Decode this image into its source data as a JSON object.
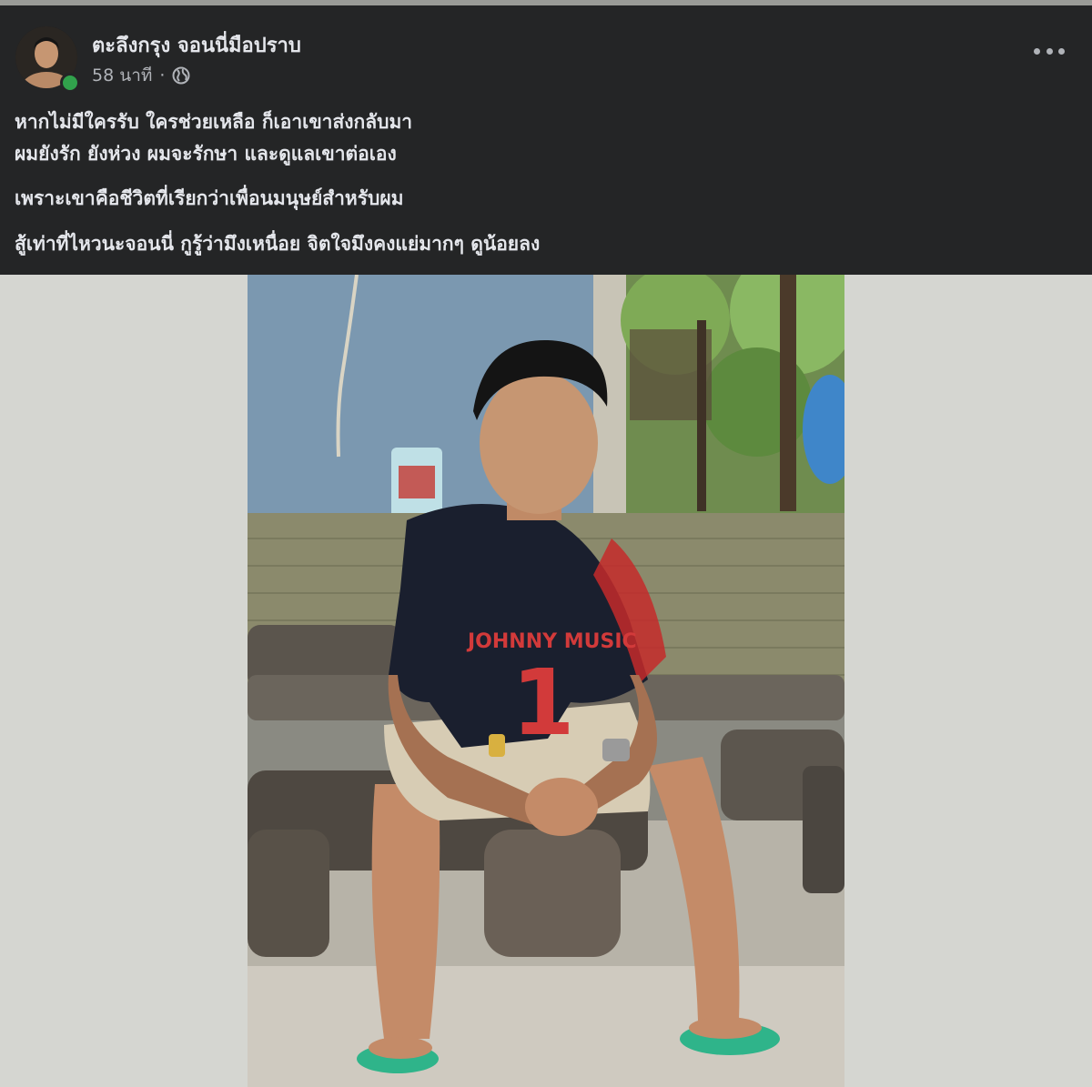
{
  "post": {
    "author": "ตะลึงกรุง จอนนี่มือปราบ",
    "time": "58 นาที",
    "separator": "·",
    "privacy_icon": "globe-icon",
    "more_icon": "more-horizontal-icon",
    "lines": [
      "หากไม่มีใครรับ ใครช่วยเหลือ  ก็เอาเขาส่งกลับมา",
      "ผมยังรัก ยังห่วง ผมจะรักษา และดูแลเขาต่อเอง",
      "เพราะเขาคือชีวิตที่เรียกว่าเพื่อนมนุษย์สำหรับผม",
      "สู้เท่าที่ไหวนะจอนนี่ กูรู้ว่ามึงเหนื่อย จิตใจมึงคงแย่มากๆ ดูน้อยลง"
    ]
  },
  "photo": {
    "shirt_text": "JOHNNY MUSIC",
    "shirt_number": "1"
  },
  "colors": {
    "header_bg": "#242526",
    "text": "#e4e6eb",
    "secondary_text": "#b0b3b8",
    "online": "#31a24c"
  }
}
